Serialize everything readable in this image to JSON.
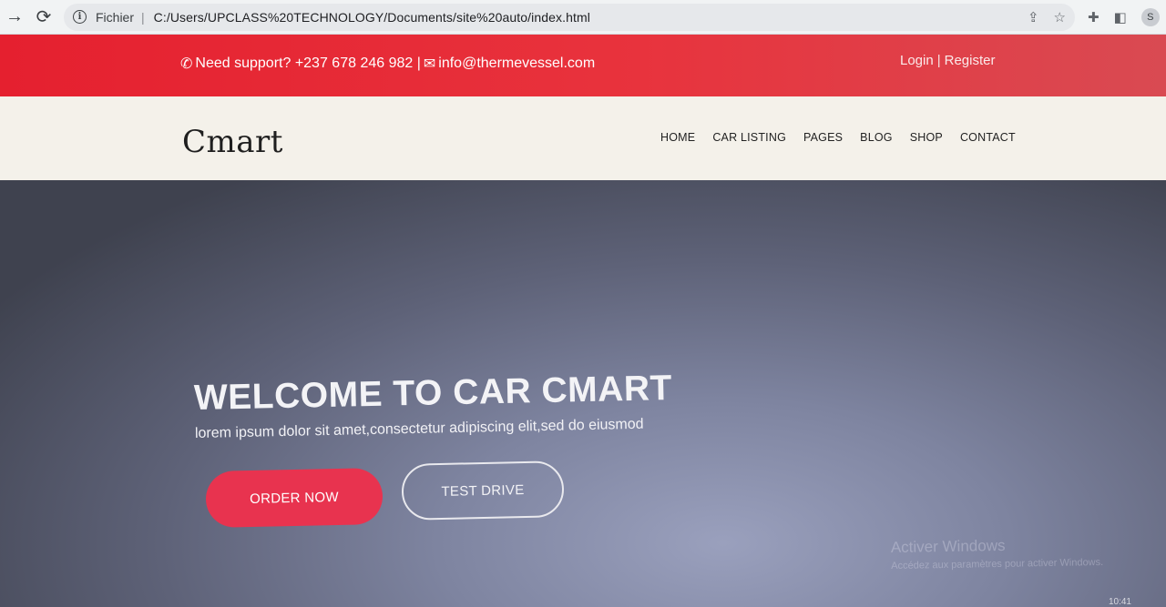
{
  "browser": {
    "scheme_label": "Fichier",
    "url": "C:/Users/UPCLASS%20TECHNOLOGY/Documents/site%20auto/index.html",
    "profile_initial": "S"
  },
  "topbar": {
    "support_text": "Need support? +237 678 246 982 |",
    "email": "info@thermevessel.com",
    "login": "Login",
    "separator": "|",
    "register": "Register"
  },
  "header": {
    "logo": "Cmart",
    "menu": [
      "HOME",
      "CAR LISTING",
      "PAGES",
      "BLOG",
      "SHOP",
      "CONTACT"
    ]
  },
  "hero": {
    "title": "WELCOME TO CAR CMART",
    "subtitle": "lorem ipsum dolor sit amet,consectetur adipiscing elit,sed do eiusmod",
    "order_button": "ORDER NOW",
    "test_button": "TEST DRIVE"
  },
  "os": {
    "activate_title": "Activer Windows",
    "activate_sub": "Accédez aux paramètres pour activer Windows.",
    "clock": "10:41"
  },
  "colors": {
    "topbar_red": "#e5202f",
    "order_pink": "#e8334f",
    "header_bg": "#f4f1ea"
  }
}
